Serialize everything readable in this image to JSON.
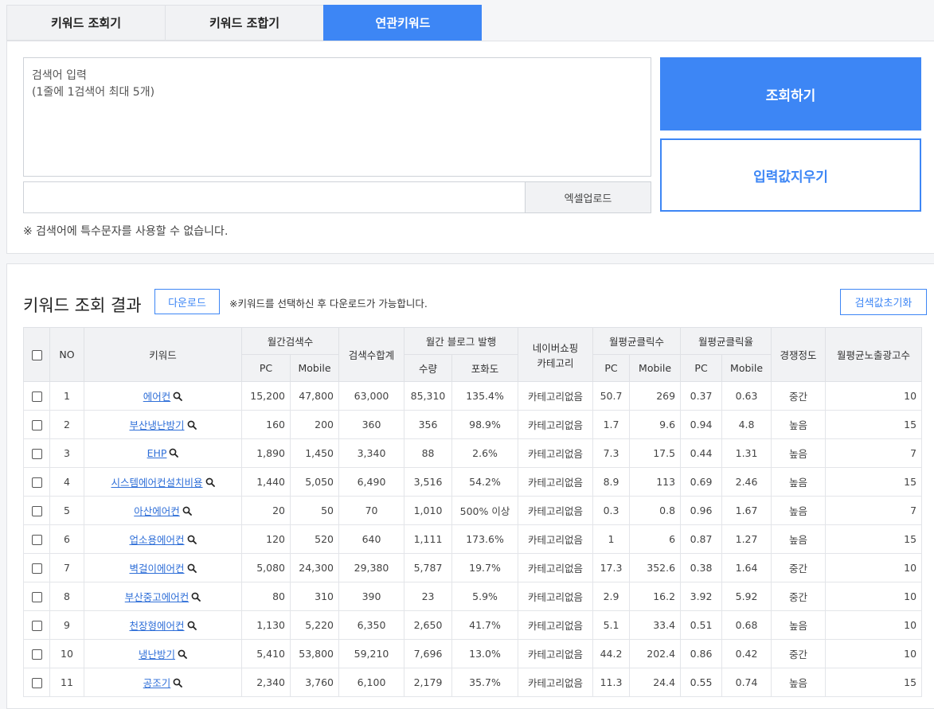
{
  "tabs": [
    {
      "label": "키워드 조회기",
      "active": false
    },
    {
      "label": "키워드 조합기",
      "active": false
    },
    {
      "label": "연관키워드",
      "active": true
    }
  ],
  "input": {
    "placeholder_line1": "검색어 입력",
    "placeholder_line2": "(1줄에 1검색어 최대 5개)",
    "excel_upload_label": "엑셀업로드",
    "notice": "※ 검색어에 특수문자를 사용할 수 없습니다.",
    "search_button": "조회하기",
    "clear_button": "입력값지우기"
  },
  "results": {
    "title": "키워드 조회 결과",
    "download_button": "다운로드",
    "download_notice": "※키워드를 선택하신 후 다운로드가 가능합니다.",
    "reset_button": "검색값초기화",
    "headers": {
      "no": "NO",
      "keyword": "키워드",
      "monthly_search": "월간검색수",
      "pc": "PC",
      "mobile": "Mobile",
      "search_total": "검색수합계",
      "blog": "월간 블로그 발행",
      "blog_count": "수량",
      "saturation": "포화도",
      "naver_shopping": "네이버쇼핑",
      "category": "카테고리",
      "avg_clicks": "월평균클릭수",
      "avg_ctr": "월평균클릭율",
      "competition": "경쟁정도",
      "ads": "월평균노출광고수"
    },
    "accent_color": "#3d86f5",
    "rows": [
      {
        "no": "1",
        "keyword": "에어컨",
        "pc": "15,200",
        "mobile": "47,800",
        "total": "63,000",
        "blog": "85,310",
        "saturation": "135.4%",
        "category": "카테고리없음",
        "click_pc": "50.7",
        "click_mobile": "269",
        "ctr_pc": "0.37",
        "ctr_mobile": "0.63",
        "competition": "중간",
        "ads": "10"
      },
      {
        "no": "2",
        "keyword": "부산냉난방기",
        "pc": "160",
        "mobile": "200",
        "total": "360",
        "blog": "356",
        "saturation": "98.9%",
        "category": "카테고리없음",
        "click_pc": "1.7",
        "click_mobile": "9.6",
        "ctr_pc": "0.94",
        "ctr_mobile": "4.8",
        "competition": "높음",
        "ads": "15"
      },
      {
        "no": "3",
        "keyword": "EHP",
        "pc": "1,890",
        "mobile": "1,450",
        "total": "3,340",
        "blog": "88",
        "saturation": "2.6%",
        "category": "카테고리없음",
        "click_pc": "7.3",
        "click_mobile": "17.5",
        "ctr_pc": "0.44",
        "ctr_mobile": "1.31",
        "competition": "높음",
        "ads": "7"
      },
      {
        "no": "4",
        "keyword": "시스템에어컨설치비용",
        "pc": "1,440",
        "mobile": "5,050",
        "total": "6,490",
        "blog": "3,516",
        "saturation": "54.2%",
        "category": "카테고리없음",
        "click_pc": "8.9",
        "click_mobile": "113",
        "ctr_pc": "0.69",
        "ctr_mobile": "2.46",
        "competition": "높음",
        "ads": "15"
      },
      {
        "no": "5",
        "keyword": "아산에어컨",
        "pc": "20",
        "mobile": "50",
        "total": "70",
        "blog": "1,010",
        "saturation": "500% 이상",
        "category": "카테고리없음",
        "click_pc": "0.3",
        "click_mobile": "0.8",
        "ctr_pc": "0.96",
        "ctr_mobile": "1.67",
        "competition": "높음",
        "ads": "7"
      },
      {
        "no": "6",
        "keyword": "업소용에어컨",
        "pc": "120",
        "mobile": "520",
        "total": "640",
        "blog": "1,111",
        "saturation": "173.6%",
        "category": "카테고리없음",
        "click_pc": "1",
        "click_mobile": "6",
        "ctr_pc": "0.87",
        "ctr_mobile": "1.27",
        "competition": "높음",
        "ads": "15"
      },
      {
        "no": "7",
        "keyword": "벽걸이에어컨",
        "pc": "5,080",
        "mobile": "24,300",
        "total": "29,380",
        "blog": "5,787",
        "saturation": "19.7%",
        "category": "카테고리없음",
        "click_pc": "17.3",
        "click_mobile": "352.6",
        "ctr_pc": "0.38",
        "ctr_mobile": "1.64",
        "competition": "중간",
        "ads": "10"
      },
      {
        "no": "8",
        "keyword": "부산중고에어컨",
        "pc": "80",
        "mobile": "310",
        "total": "390",
        "blog": "23",
        "saturation": "5.9%",
        "category": "카테고리없음",
        "click_pc": "2.9",
        "click_mobile": "16.2",
        "ctr_pc": "3.92",
        "ctr_mobile": "5.92",
        "competition": "중간",
        "ads": "10"
      },
      {
        "no": "9",
        "keyword": "천장형에어컨",
        "pc": "1,130",
        "mobile": "5,220",
        "total": "6,350",
        "blog": "2,650",
        "saturation": "41.7%",
        "category": "카테고리없음",
        "click_pc": "5.1",
        "click_mobile": "33.4",
        "ctr_pc": "0.51",
        "ctr_mobile": "0.68",
        "competition": "높음",
        "ads": "10"
      },
      {
        "no": "10",
        "keyword": "냉난방기",
        "pc": "5,410",
        "mobile": "53,800",
        "total": "59,210",
        "blog": "7,696",
        "saturation": "13.0%",
        "category": "카테고리없음",
        "click_pc": "44.2",
        "click_mobile": "202.4",
        "ctr_pc": "0.86",
        "ctr_mobile": "0.42",
        "competition": "중간",
        "ads": "10"
      },
      {
        "no": "11",
        "keyword": "공조기",
        "pc": "2,340",
        "mobile": "3,760",
        "total": "6,100",
        "blog": "2,179",
        "saturation": "35.7%",
        "category": "카테고리없음",
        "click_pc": "11.3",
        "click_mobile": "24.4",
        "ctr_pc": "0.55",
        "ctr_mobile": "0.74",
        "competition": "높음",
        "ads": "15"
      }
    ]
  }
}
